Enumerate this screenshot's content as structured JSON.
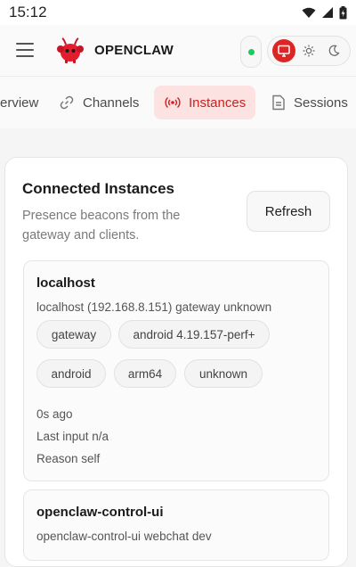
{
  "status_bar": {
    "time": "15:12"
  },
  "app": {
    "brand": "OPENCLAW"
  },
  "tabs": [
    {
      "label": "erview"
    },
    {
      "label": "Channels"
    },
    {
      "label": "Instances"
    },
    {
      "label": "Sessions"
    }
  ],
  "section": {
    "title": "Connected Instances",
    "subtitle": "Presence beacons from the gateway and clients.",
    "refresh_label": "Refresh"
  },
  "instances": [
    {
      "name": "localhost",
      "description": "localhost (192.168.8.151) gateway unknown",
      "chips": [
        "gateway",
        "android 4.19.157-perf+",
        "android",
        "arm64",
        "unknown"
      ],
      "last_seen": "0s ago",
      "last_input": "Last input n/a",
      "reason": "Reason self"
    },
    {
      "name": "openclaw-control-ui",
      "description": "openclaw-control-ui webchat dev"
    }
  ],
  "colors": {
    "accent": "#dc2626",
    "accent_soft": "#fde2e2",
    "online": "#22c55e"
  }
}
